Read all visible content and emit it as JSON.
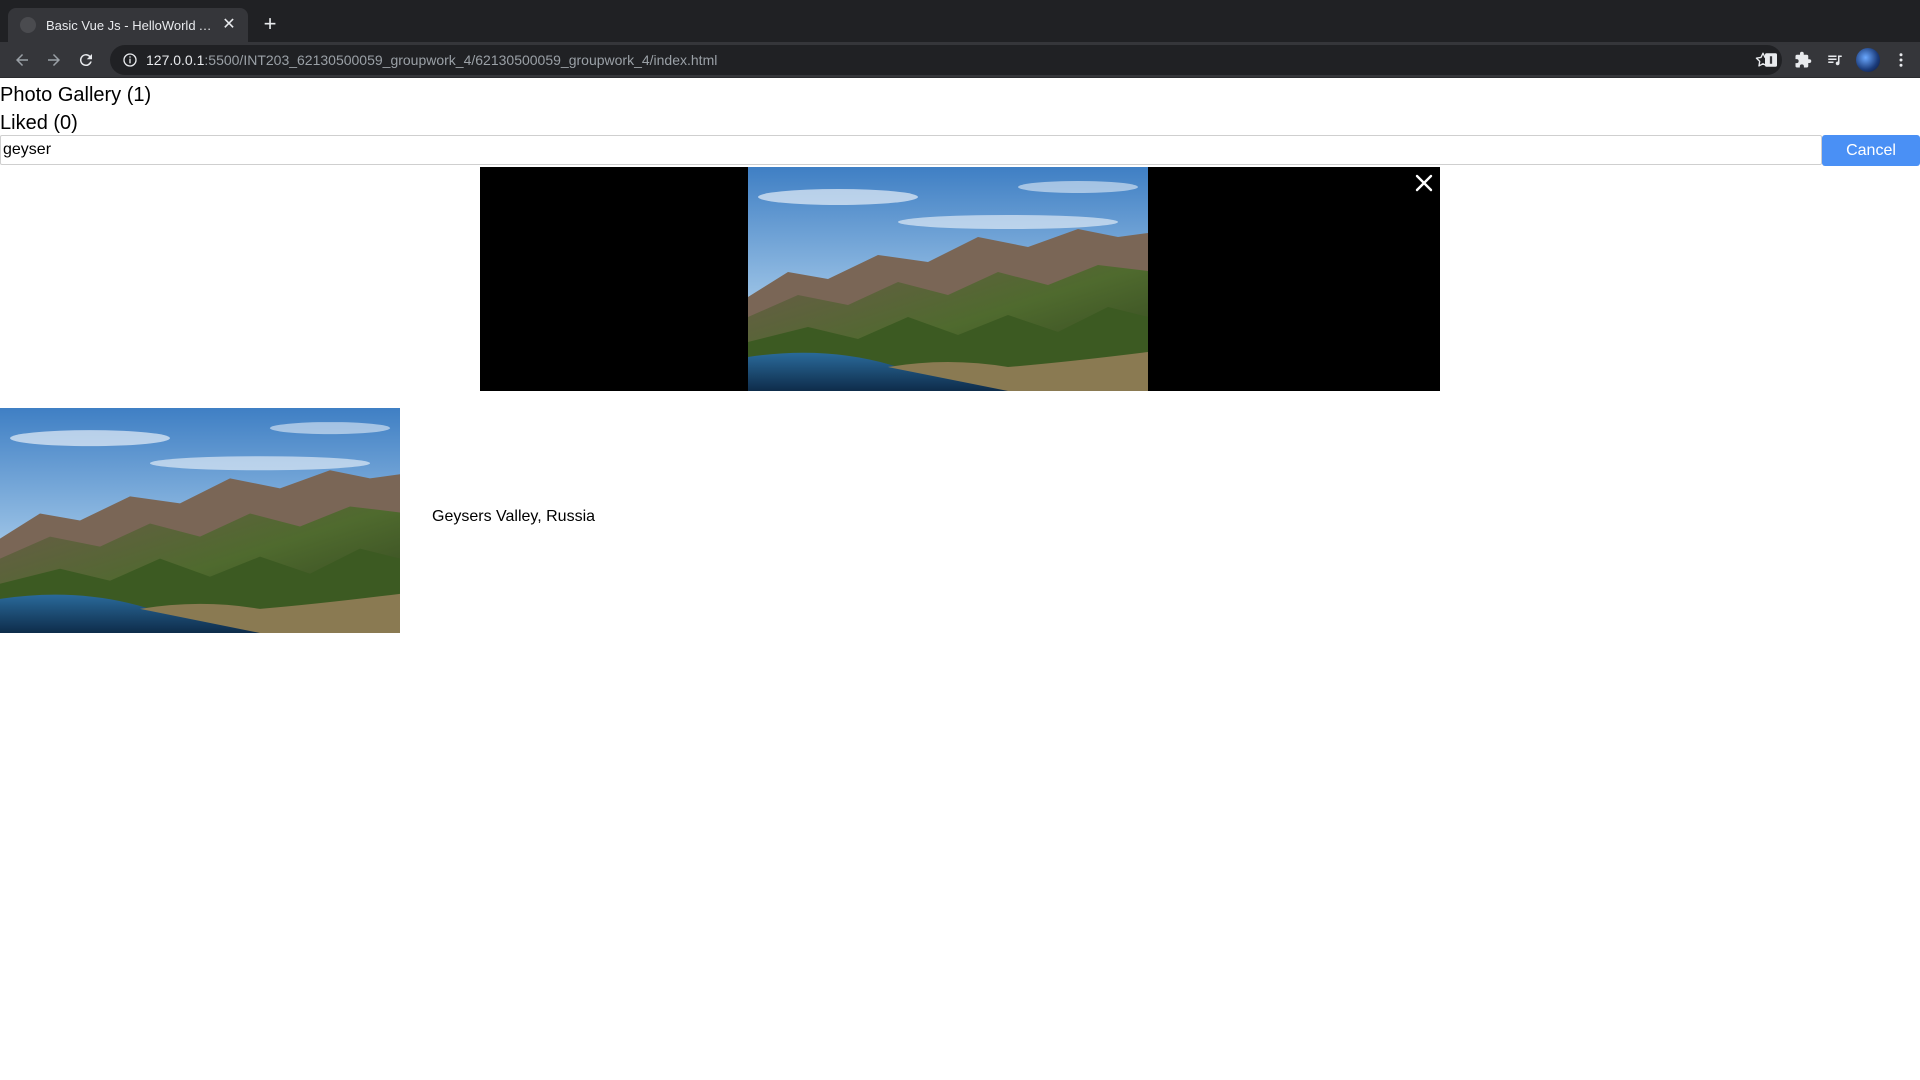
{
  "browser": {
    "tab_title": "Basic Vue Js - HelloWorld App",
    "tab_close": "✕",
    "new_tab": "+",
    "url_host": "127.0.0.1",
    "url_rest": ":5500/INT203_62130500059_groupwork_4/62130500059_groupwork_4/index.html",
    "icons": [
      "back-arrow-icon",
      "forward-arrow-icon",
      "reload-icon",
      "info-icon",
      "bookmark-star-icon",
      "extension-i-icon",
      "puzzle-icon",
      "media-queue-icon",
      "profile-avatar",
      "kebab-menu-icon"
    ]
  },
  "page": {
    "gallery_heading": "Photo Gallery (1)",
    "liked_heading": "Liked (0)",
    "search": {
      "value": "geyser",
      "placeholder": ""
    },
    "cancel_label": "Cancel",
    "accent_color": "#4a90f5",
    "viewer": {
      "close_icon": "close-icon"
    },
    "photos": [
      {
        "caption": "Geysers Valley, Russia"
      }
    ]
  }
}
